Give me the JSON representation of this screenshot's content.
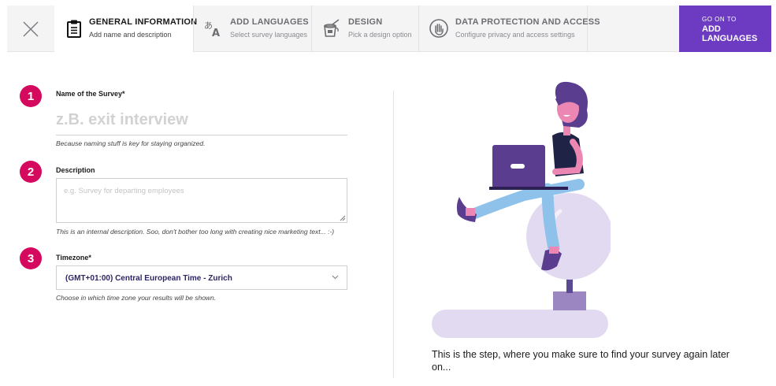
{
  "nav": {
    "close_icon": "close-icon",
    "steps": [
      {
        "title": "GENERAL INFORMATION",
        "subtitle": "Add name and description",
        "icon": "clipboard-icon"
      },
      {
        "title": "ADD LANGUAGES",
        "subtitle": "Select survey languages",
        "icon": "translate-icon"
      },
      {
        "title": "DESIGN",
        "subtitle": "Pick a design option",
        "icon": "paint-bucket-icon"
      },
      {
        "title": "DATA PROTECTION AND ACCESS",
        "subtitle": "Configure privacy and access settings",
        "icon": "hand-icon"
      }
    ],
    "go_on": {
      "small": "GO ON TO",
      "line1": "ADD",
      "line2": "LANGUAGES"
    }
  },
  "form": {
    "name": {
      "badge": "1",
      "label": "Name of the Survey*",
      "placeholder": "z.B. exit interview",
      "value": "",
      "hint": "Because naming stuff is key for staying organized."
    },
    "description": {
      "badge": "2",
      "label": "Description",
      "placeholder": "e.g. Survey for departing employees",
      "value": "",
      "hint": "This is an internal description. Soo, don't bother too long with creating nice marketing text... :-)"
    },
    "timezone": {
      "badge": "3",
      "label": "Timezone*",
      "value": "(GMT+01:00) Central European Time - Zurich",
      "hint": "Choose in which time zone your results will be shown."
    }
  },
  "side": {
    "caption": "This is the step, where you make sure to find your survey again later on..."
  },
  "colors": {
    "accent": "#6c3bc2",
    "badge": "#d5095d",
    "select_text": "#2c2566",
    "topbar_bg": "#f4f4f5"
  }
}
